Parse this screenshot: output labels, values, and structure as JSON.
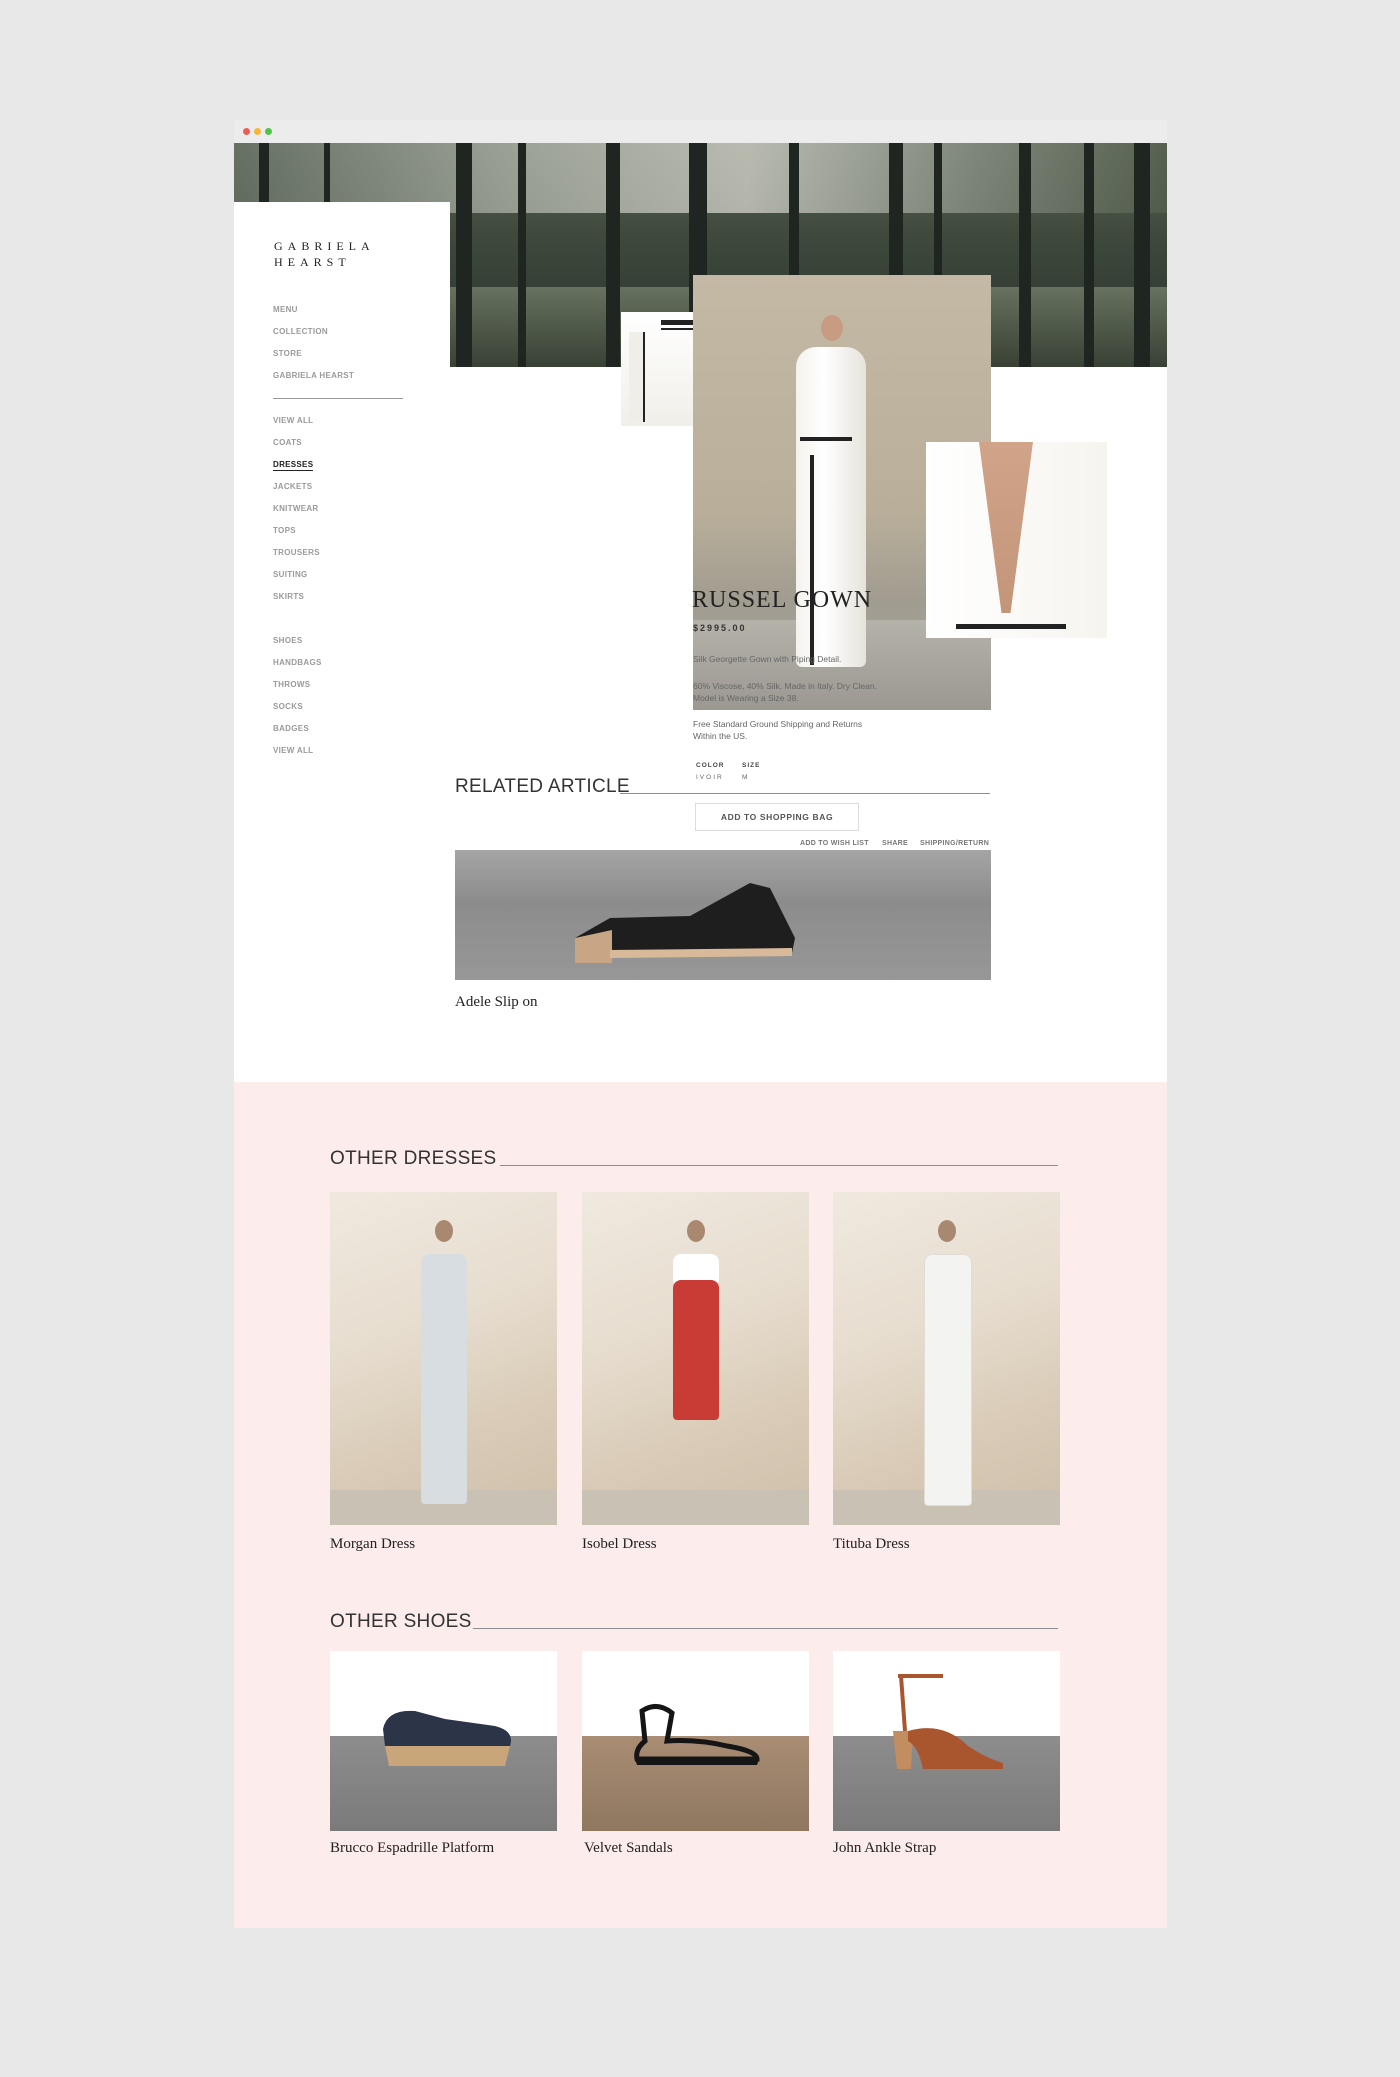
{
  "brand": {
    "line1": "GABRIELA",
    "line2": "HEARST"
  },
  "nav_primary": [
    "MENU",
    "COLLECTION",
    "STORE",
    "GABRIELA HEARST"
  ],
  "nav_categories": [
    "VIEW ALL",
    "COATS",
    "DRESSES",
    "JACKETS",
    "KNITWEAR",
    "TOPS",
    "TROUSERS",
    "SUITING",
    "SKIRTS"
  ],
  "nav_accessories": [
    "SHOES",
    "HANDBAGS",
    "THROWS",
    "SOCKS",
    "BADGES",
    "VIEW ALL"
  ],
  "nav_active": "DRESSES",
  "product": {
    "title": "RUSSEL GOWN",
    "price": "$2995.00",
    "desc1": "Silk Georgette Gown with Piping Detail.",
    "desc2a": "60% Viscose, 40% Silk. Made in Italy. Dry Clean.",
    "desc2b": "Model is Wearing a Size 38.",
    "desc3a": "Free Standard Ground Shipping and Returns",
    "desc3b": "Within the US.",
    "color_label": "COLOR",
    "color_value": "IVOIR",
    "size_label": "SIZE",
    "size_value": "M",
    "add_button": "ADD TO SHOPPING BAG",
    "links": {
      "wishlist": "ADD TO WISH LIST",
      "share": "SHARE",
      "shipping": "SHIPPING/RETURN"
    }
  },
  "related": {
    "heading": "RELATED ARTICLE",
    "caption": "Adele Slip on"
  },
  "other_dresses": {
    "heading": "OTHER DRESSES",
    "items": [
      {
        "name": "Morgan Dress",
        "color": "#d8dde2"
      },
      {
        "name": "Isobel Dress",
        "color": "#c93b35"
      },
      {
        "name": "Tituba Dress",
        "color": "#f3f3f1"
      }
    ]
  },
  "other_shoes": {
    "heading": "OTHER SHOES",
    "items": [
      {
        "name": "Brucco Espadrille Platform"
      },
      {
        "name": "Velvet Sandals"
      },
      {
        "name": "John Ankle Strap"
      }
    ]
  }
}
